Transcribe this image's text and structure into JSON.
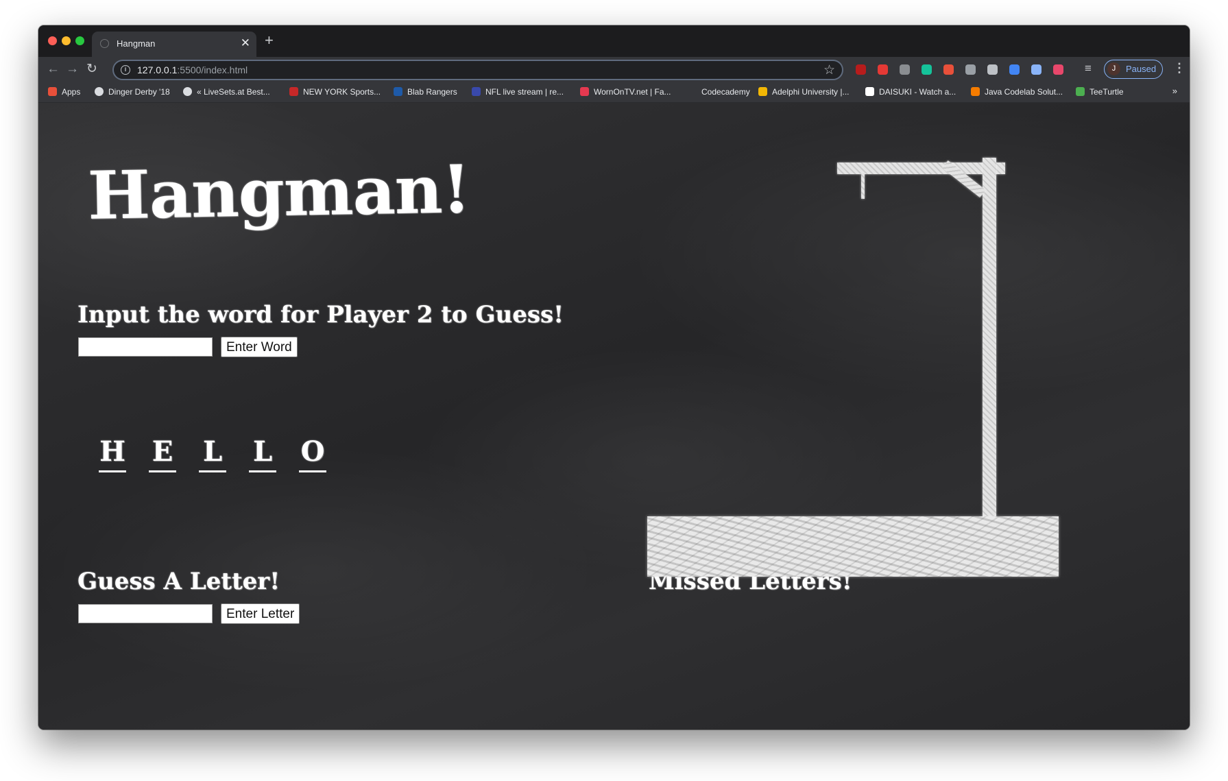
{
  "browser": {
    "tab_title": "Hangman",
    "new_tab_symbol": "+",
    "close_symbol": "✕",
    "url_host": "127.0.0.1",
    "url_path": ":5500/index.html",
    "profile_initial": "J",
    "profile_status": "Paused",
    "extensions": [
      {
        "name": "ublock-icon",
        "color": "#b71c1c"
      },
      {
        "name": "adblock-icon",
        "color": "#e53935"
      },
      {
        "name": "screenshot-icon",
        "color": "#8a8d91"
      },
      {
        "name": "grammar-icon",
        "color": "#15c39a"
      },
      {
        "name": "analytics-icon",
        "color": "#e8503a"
      },
      {
        "name": "translate-icon",
        "color": "#9aa0a6"
      },
      {
        "name": "check-icon",
        "color": "#bdc1c6"
      },
      {
        "name": "pen-icon",
        "color": "#4285f4"
      },
      {
        "name": "circle-icon",
        "color": "#8ab4f8"
      },
      {
        "name": "t-badge-icon",
        "color": "#e8476b"
      }
    ]
  },
  "bookmarks": [
    {
      "label": "Apps",
      "icon": "apps-grid-icon",
      "color": "#e8503a"
    },
    {
      "label": "Dinger Derby '18",
      "icon": "globe-icon",
      "color": "#dadce0"
    },
    {
      "label": "« LiveSets.at Best...",
      "icon": "globe-icon",
      "color": "#dadce0"
    },
    {
      "label": "NEW YORK Sports...",
      "icon": "nysports-icon",
      "color": "#c62828"
    },
    {
      "label": "Blab Rangers",
      "icon": "rangers-icon",
      "color": "#1e5aa8"
    },
    {
      "label": "NFL live stream | re...",
      "icon": "nfl-icon",
      "color": "#3949ab"
    },
    {
      "label": "WornOnTV.net | Fa...",
      "icon": "wornontv-icon",
      "color": "#e53950"
    },
    {
      "label": "Codecademy",
      "icon": "codecademy-icon",
      "color": "#35363a"
    },
    {
      "label": "Adelphi University |...",
      "icon": "adelphi-icon",
      "color": "#f2b705"
    },
    {
      "label": "DAISUKI - Watch a...",
      "icon": "daisuki-icon",
      "color": "#ffffff"
    },
    {
      "label": "Java Codelab Solut...",
      "icon": "blogger-icon",
      "color": "#f57c00"
    },
    {
      "label": "TeeTurtle",
      "icon": "turtle-icon",
      "color": "#4caf50"
    }
  ],
  "bookmarks_overflow": "»",
  "game": {
    "title": "Hangman!",
    "word_prompt": "Input the word for Player 2 to Guess!",
    "word_input_value": "",
    "enter_word_label": "Enter Word",
    "revealed_letters": [
      "H",
      "E",
      "L",
      "L",
      "O"
    ],
    "guess_prompt": "Guess A Letter!",
    "letter_input_value": "",
    "enter_letter_label": "Enter Letter",
    "missed_heading": "Missed Letters!"
  }
}
